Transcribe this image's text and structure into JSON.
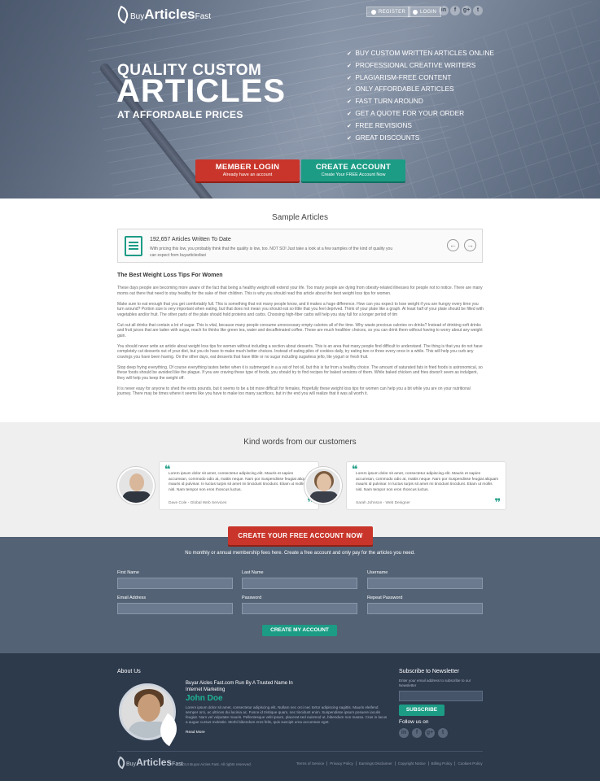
{
  "header": {
    "logo": {
      "part1": "Buy",
      "part2": "Articles",
      "part3": "Fast"
    },
    "register_label": "REGISTER",
    "login_label": "LOGIN",
    "social": [
      "in",
      "f",
      "g+",
      "t"
    ]
  },
  "hero": {
    "title_line1": "QUALITY CUSTOM",
    "title_line2": "ARTICLES",
    "title_line3": "AT AFFORDABLE PRICES",
    "features": [
      "BUY CUSTOM WRITTEN ARTICLES ONLINE",
      "PROFESSIONAL CREATIVE WRITERS",
      "PLAGIARISM-FREE CONTENT",
      "ONLY AFFORDABLE ARTICLES",
      "FAST TURN AROUND",
      "GET A QUOTE FOR YOUR ORDER",
      "FREE REVISIONS",
      "GREAT DISCOUNTS"
    ],
    "member_login": {
      "title": "MEMBER LOGIN",
      "subtitle": "Already have an account"
    },
    "create_account": {
      "title": "CREATE ACCOUNT",
      "subtitle": "Create Your FREE Account Now"
    }
  },
  "samples": {
    "heading": "Sample Articles",
    "count_text": "192,657 Articles Written To Date",
    "description": "With pricing this low, you probably think that the quality is low, too. NOT SO! Just take a look at a few samples of the kind of quality you can expect from buyarticlesfast",
    "prev_icon": "arrow-left-icon",
    "next_icon": "arrow-right-icon"
  },
  "article": {
    "title": "The Best Weight Loss Tips For Women",
    "paragraphs": [
      "These days people are becoming more aware of the fact that being a healthy weight will extend your life. Too many people are dying from obesity-related illnesses for people not to notice. There are many moms out there that need to stay healthy for the sake of their children. This is why you should read this article about the best weight loss tips for women.",
      "Make sure to eat enough that you get comfortably full. This is something that not many people know, and it makes a huge difference. How can you expect to lose weight if you are hungry every time you turn around? Portion size is very important when eating, but that does not mean you should eat so little that you feel deprived. Think of your plate like a graph. At least half of your plate should be filled with vegetables and/or fruit. The other parts of the plate should hold proteins and carbs. Choosing high-fiber carbs will help you stay full for a longer period of tim",
      "Cut out all drinks that contain a lot of sugar. This is vital, because many people consume unnecessary empty calories all of the time. Why waste precious calories on drinks? Instead of drinking soft drinks and fruit juices that are laden with sugar, reach for thinks like green tea, water and decaffeinated coffee. These are much healthier choices, so you can drink them without having to worry about any weight gain.",
      "You should never write an article about weight loss tips for women without including a section about desserts. This is an area that many people find difficult to understand. The thing is that you do not have completely cut desserts out of your diet, but you do have to make much better choices. Instead of eating piles of cookies daily, try eating two or three every once in a while. This will help you curb any cravings you have been having. On the other days, eat desserts that have little or no sugar including sugarless jello, lite yogurt or fresh fruit.",
      "Stop deep frying everything. Of course everything tastes better when it is submerged in a a vat of hot oil, but this is far from a healthy choice. The amount of saturated fats in fried foods is astronomical, so these foods should be avoided like the plague. If you are craving these type of foods, you should try to find recipes for baked versions of them. While baked chicken and fries doesn't seem as indulgent, they will help you keep the weight off.",
      "It is never easy for anyone to shed the extra pounds, but it seems to be a bit more difficult for females. Hopefully these weight loss tips for women can help you a bit while you are on your nutritional journey. There may be times where it seems like you have to make too many sacrifices, but in the end you will realize that it was all worth it."
    ]
  },
  "testimonials": {
    "heading": "Kind words from our customers",
    "items": [
      {
        "text": "Lorem ipsum dolor sit amet, consectetur adipiscing elit. Mauris et sapien accumsan, commodo odio at, mattis neque. Nam por Suspendisse feugiat aliquam mauris id pulvinar. In luctus turpis sit amet mi tincidunt tincidunt. Etiam ut mollis nisl. Nam tempor non eros rhoncus luctus.",
        "author": "Dave Cole - Global Web Services"
      },
      {
        "text": "Lorem ipsum dolor sit amet, consectetur adipiscing elit. Mauris et sapien accumsan, commodo odio at, mattis neque. Nam por Suspendisse feugiat aliquam mauris id pulvinar. In luctus turpis sit amet mi tincidunt tincidunt. Etiam ut mollis nisl. Nam tempor non eros rhoncus luctus.",
        "author": "Sarah Johnson - Web Designer"
      }
    ]
  },
  "signup": {
    "cta": "CREATE YOUR FREE ACCOUNT NOW",
    "note": "No monthly or annual membership fees here. Create a free account and only pay for the articles you need.",
    "fields": [
      "First Name",
      "Last Name",
      "Username",
      "Email Address",
      "Password",
      "Repeat Password"
    ],
    "button": "CREATE MY ACCOUNT"
  },
  "footer": {
    "about_heading": "About Us",
    "tagline": "Buyar Aicles Fast.com Run By A Trusted Name In Internet Marketing",
    "name": "John Doe",
    "bio": "Lorem ipsum dolor sit amet, consectetur adipiscing elit. Nullam nec orci nec tortor adipiscing sagittis. Mauris eleifend semper orci, ac ultrices dui lacinia ac. Fusce id tristique quam, nec tincidunt enim. Suspendisse ipsum posuere iaculis feugiat. Nam vel vulputate mauris. Pellentesque velit ipsum, placerat sed euismod ut, bibendum non massa. Cras in lacus a augue cursus molestie. Morbi bibendum eros felis, quis suscipit urna accumsan eget.",
    "read_more": "Read More",
    "subscribe_heading": "Subscribe to Newsletter",
    "subscribe_text": "Enter your email address to subscribe to our Newsletter",
    "subscribe_button": "SUBSCRIBE",
    "follow_heading": "Follow us on",
    "social": [
      "in",
      "f",
      "g+",
      "t"
    ],
    "logo": {
      "part1": "Buy",
      "part2": "Articles",
      "part3": "Fast"
    },
    "copyright": "© 2014 Buyar Aicles Fast. All rights reserved.",
    "links": [
      "Terms of Service",
      "Privacy Policy",
      "Earnings Disclaimer",
      "Copyright Notice",
      "Billing Policy",
      "Cookies Policy"
    ]
  }
}
